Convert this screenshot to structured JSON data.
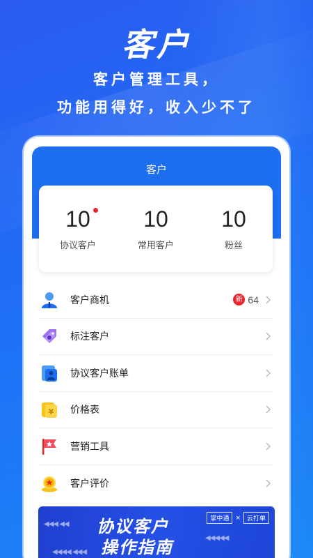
{
  "promo": {
    "title": "客户",
    "line1": "客户管理工具，",
    "line2": "功能用得好，收入少不了"
  },
  "screen": {
    "header_title": "客户",
    "stats": [
      {
        "value": "10",
        "label": "协议客户",
        "has_dot": true
      },
      {
        "value": "10",
        "label": "常用客户",
        "has_dot": false
      },
      {
        "value": "10",
        "label": "粉丝",
        "has_dot": false
      }
    ],
    "menu": [
      {
        "label": "客户商机",
        "icon": "person-icon",
        "badge": "新",
        "count": "64"
      },
      {
        "label": "标注客户",
        "icon": "tag-icon"
      },
      {
        "label": "协议客户账单",
        "icon": "bill-icon"
      },
      {
        "label": "价格表",
        "icon": "price-icon"
      },
      {
        "label": "营销工具",
        "icon": "flag-icon"
      },
      {
        "label": "客户评价",
        "icon": "medal-icon"
      }
    ],
    "banner": {
      "title_line1": "协议客户",
      "title_line2": "操作指南",
      "tag1": "掌中通",
      "tag_sep": "×",
      "tag2": "云打单"
    }
  },
  "colors": {
    "accent": "#1e6ff0",
    "badge_red": "#e8262d"
  }
}
